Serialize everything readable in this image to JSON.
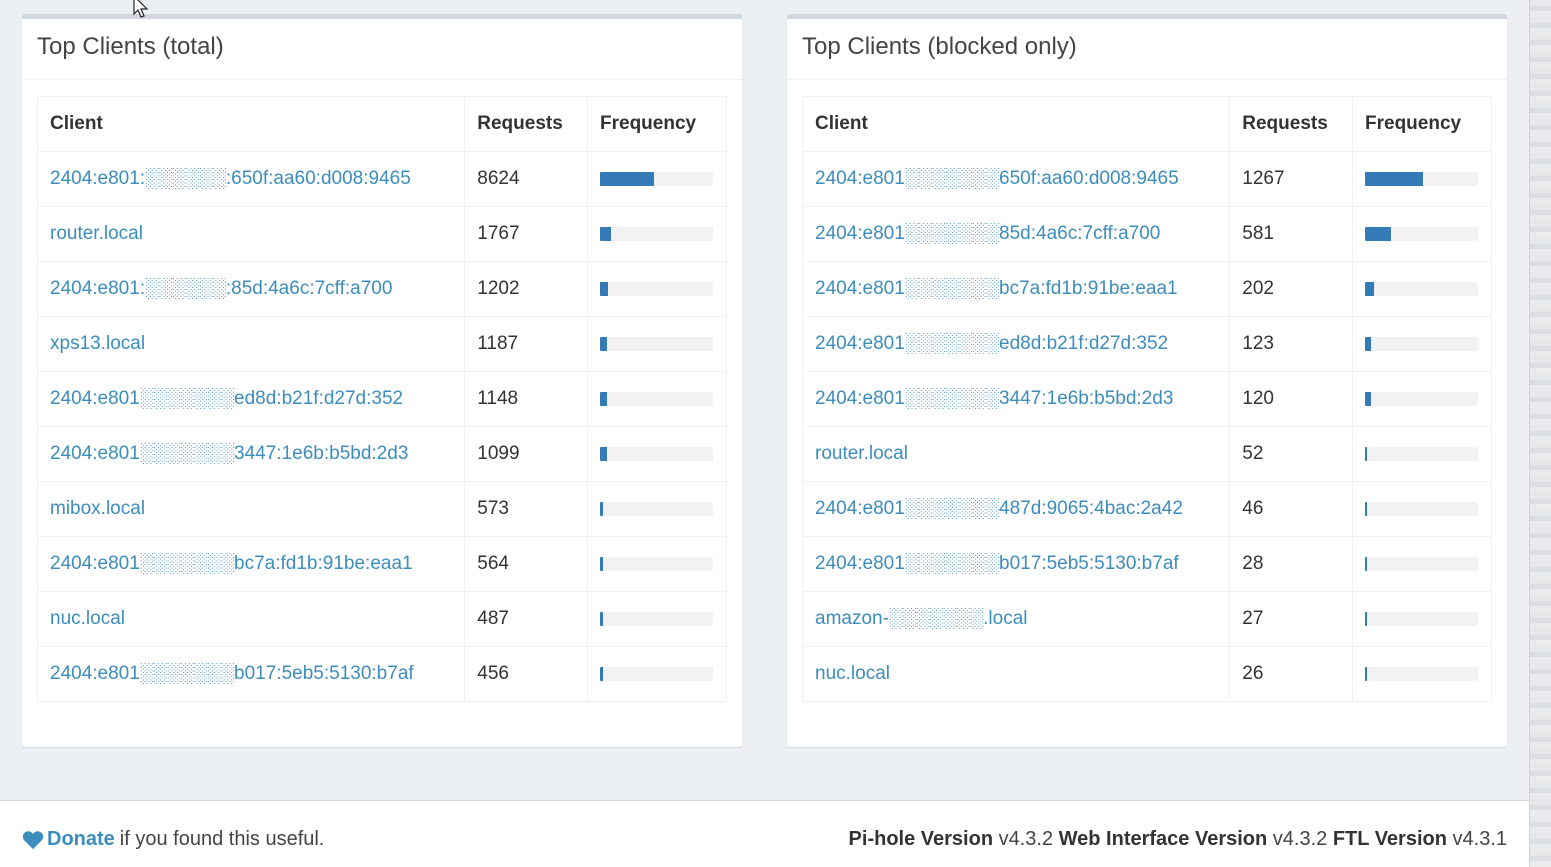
{
  "panels": [
    {
      "title": "Top Clients (total)",
      "columns": [
        "Client",
        "Requests",
        "Frequency"
      ],
      "rows": [
        {
          "client": "2404:e801:░░░░░░:650f:aa60:d008:9465",
          "requests": "8624",
          "frequency": 0.48
        },
        {
          "client": "router.local",
          "requests": "1767",
          "frequency": 0.1
        },
        {
          "client": "2404:e801:░░░░░░:85d:4a6c:7cff:a700",
          "requests": "1202",
          "frequency": 0.07
        },
        {
          "client": "xps13.local",
          "requests": "1187",
          "frequency": 0.06
        },
        {
          "client": "2404:e801░░░░░░░ed8d:b21f:d27d:352",
          "requests": "1148",
          "frequency": 0.06
        },
        {
          "client": "2404:e801░░░░░░░3447:1e6b:b5bd:2d3",
          "requests": "1099",
          "frequency": 0.06
        },
        {
          "client": "mibox.local",
          "requests": "573",
          "frequency": 0.03
        },
        {
          "client": "2404:e801░░░░░░░bc7a:fd1b:91be:eaa1",
          "requests": "564",
          "frequency": 0.03
        },
        {
          "client": "nuc.local",
          "requests": "487",
          "frequency": 0.03
        },
        {
          "client": "2404:e801░░░░░░░b017:5eb5:5130:b7af",
          "requests": "456",
          "frequency": 0.025
        }
      ]
    },
    {
      "title": "Top Clients (blocked only)",
      "columns": [
        "Client",
        "Requests",
        "Frequency"
      ],
      "rows": [
        {
          "client": "2404:e801░░░░░░░650f:aa60:d008:9465",
          "requests": "1267",
          "frequency": 0.51
        },
        {
          "client": "2404:e801░░░░░░░85d:4a6c:7cff:a700",
          "requests": "581",
          "frequency": 0.23
        },
        {
          "client": "2404:e801░░░░░░░bc7a:fd1b:91be:eaa1",
          "requests": "202",
          "frequency": 0.08
        },
        {
          "client": "2404:e801░░░░░░░ed8d:b21f:d27d:352",
          "requests": "123",
          "frequency": 0.05
        },
        {
          "client": "2404:e801░░░░░░░3447:1e6b:b5bd:2d3",
          "requests": "120",
          "frequency": 0.05
        },
        {
          "client": "router.local",
          "requests": "52",
          "frequency": 0.02
        },
        {
          "client": "2404:e801░░░░░░░487d:9065:4bac:2a42",
          "requests": "46",
          "frequency": 0.02
        },
        {
          "client": "2404:e801░░░░░░░b017:5eb5:5130:b7af",
          "requests": "28",
          "frequency": 0.011
        },
        {
          "client": "amazon-░░░░░░░.local",
          "requests": "27",
          "frequency": 0.011
        },
        {
          "client": "nuc.local",
          "requests": "26",
          "frequency": 0.01
        }
      ]
    }
  ],
  "footer": {
    "donate_link": "Donate",
    "donate_text": "if you found this useful.",
    "pihole_label": "Pi-hole Version",
    "pihole_version": "v4.3.2",
    "web_label": "Web Interface Version",
    "web_version": "v4.3.2",
    "ftl_label": "FTL Version",
    "ftl_version": "v4.3.1"
  },
  "icons": {
    "heart": "heart-icon",
    "cursor": "mouse-cursor-icon"
  },
  "colors": {
    "link": "#3c8dbc",
    "bar": "#337ab7",
    "bar_bg": "#f2f2f2"
  }
}
